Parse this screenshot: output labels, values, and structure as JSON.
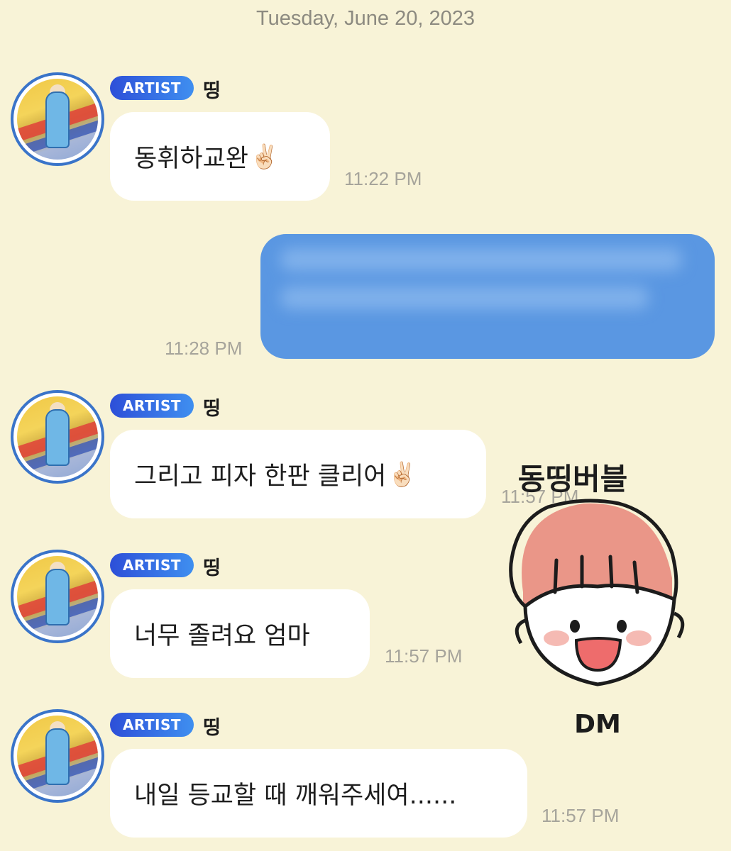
{
  "chat": {
    "date": "Tuesday, June 20, 2023",
    "artist_badge": "ARTIST",
    "sender_name": "띵",
    "messages": [
      {
        "text": "동휘하교완",
        "emoji": "✌🏻",
        "time": "11:22 PM"
      },
      {
        "text": "그리고 피자 한판 클리어",
        "emoji": "✌🏻",
        "time": "11:57 PM"
      },
      {
        "text": "너무 졸려요 엄마",
        "emoji": "",
        "time": "11:57 PM"
      },
      {
        "text": "내일 등교할 때 깨워주세여......",
        "emoji": "",
        "time": "11:57 PM"
      }
    ],
    "my_message": {
      "time": "11:28 PM",
      "color": "#5a97e2"
    }
  },
  "sticker": {
    "caption_top": "동띵버블",
    "caption_bottom": "DM"
  },
  "colors": {
    "background": "#f8f3d7",
    "badge_start": "#2d4fd8",
    "badge_end": "#3f8ff0",
    "avatar_ring": "#3a74c9"
  }
}
